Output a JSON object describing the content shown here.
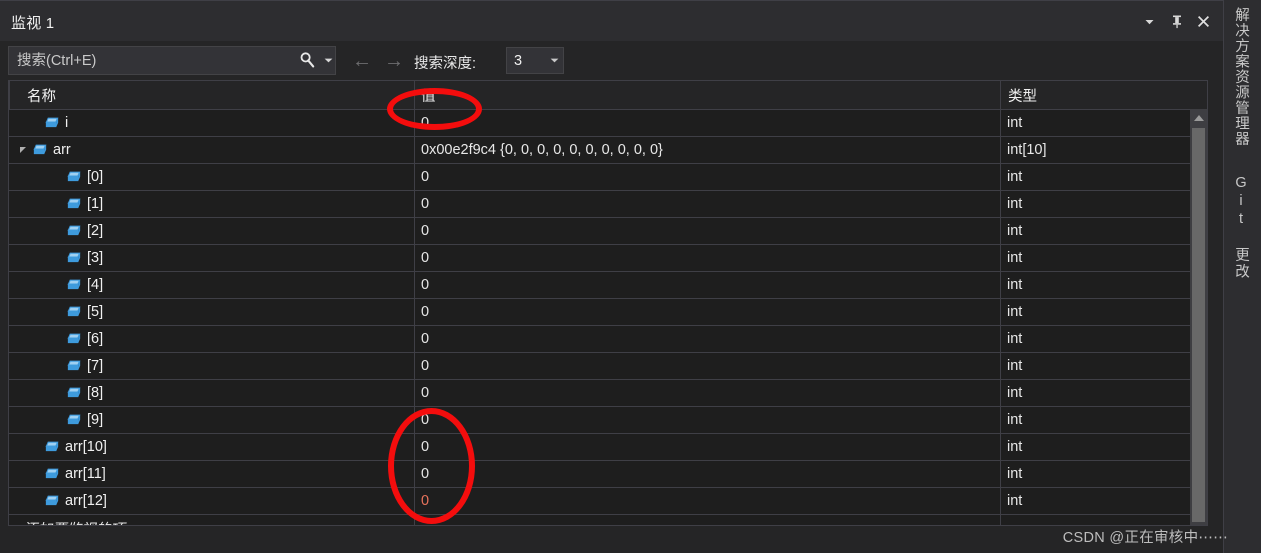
{
  "window": {
    "title": "监视 1",
    "buttons": [
      {
        "name": "window-dropdown",
        "icon": "chevron-down-icon"
      },
      {
        "name": "window-pin",
        "icon": "pin-icon"
      },
      {
        "name": "window-close",
        "icon": "close-icon"
      }
    ]
  },
  "toolbar": {
    "search_placeholder": "搜索(Ctrl+E)",
    "search_value": "",
    "search_icon": "magnifier-icon",
    "search_dropdown_icon": "chevron-down-icon",
    "back_arrow": "←",
    "forward_arrow": "→",
    "depth_label": "搜索深度:",
    "depth_value": "3",
    "depth_caret_icon": "chevron-down-icon"
  },
  "grid": {
    "columns": [
      {
        "key": "name",
        "label": "名称"
      },
      {
        "key": "value",
        "label": "值"
      },
      {
        "key": "type",
        "label": "类型"
      }
    ],
    "rows": [
      {
        "name": "i",
        "value": "0",
        "type": "int",
        "indent": 1,
        "expander": "none",
        "changed": false
      },
      {
        "name": "arr",
        "value": "0x00e2f9c4 {0, 0, 0, 0, 0, 0, 0, 0, 0, 0}",
        "type": "int[10]",
        "indent": 1,
        "expander": "expanded",
        "changed": false
      },
      {
        "name": "[0]",
        "value": "0",
        "type": "int",
        "indent": 2,
        "expander": "none",
        "changed": false
      },
      {
        "name": "[1]",
        "value": "0",
        "type": "int",
        "indent": 2,
        "expander": "none",
        "changed": false
      },
      {
        "name": "[2]",
        "value": "0",
        "type": "int",
        "indent": 2,
        "expander": "none",
        "changed": false
      },
      {
        "name": "[3]",
        "value": "0",
        "type": "int",
        "indent": 2,
        "expander": "none",
        "changed": false
      },
      {
        "name": "[4]",
        "value": "0",
        "type": "int",
        "indent": 2,
        "expander": "none",
        "changed": false
      },
      {
        "name": "[5]",
        "value": "0",
        "type": "int",
        "indent": 2,
        "expander": "none",
        "changed": false
      },
      {
        "name": "[6]",
        "value": "0",
        "type": "int",
        "indent": 2,
        "expander": "none",
        "changed": false
      },
      {
        "name": "[7]",
        "value": "0",
        "type": "int",
        "indent": 2,
        "expander": "none",
        "changed": false
      },
      {
        "name": "[8]",
        "value": "0",
        "type": "int",
        "indent": 2,
        "expander": "none",
        "changed": false
      },
      {
        "name": "[9]",
        "value": "0",
        "type": "int",
        "indent": 2,
        "expander": "none",
        "changed": false
      },
      {
        "name": "arr[10]",
        "value": "0",
        "type": "int",
        "indent": 1,
        "expander": "none",
        "changed": false
      },
      {
        "name": "arr[11]",
        "value": "0",
        "type": "int",
        "indent": 1,
        "expander": "none",
        "changed": false
      },
      {
        "name": "arr[12]",
        "value": "0",
        "type": "int",
        "indent": 1,
        "expander": "none",
        "changed": true
      }
    ],
    "add_item_placeholder": "添加要监视的项"
  },
  "right_strip": {
    "tabs": [
      {
        "label": "解决方案资源管理器",
        "name": "solution-explorer"
      },
      {
        "label": "Git 更改",
        "name": "git-changes"
      }
    ]
  },
  "watermark": "CSDN @正在审核中⋯⋯",
  "colors": {
    "accent_red": "#f40d0d",
    "changed_value": "#e8735c",
    "icon_blue": "#3e9bdd",
    "panel_bg": "#252526",
    "grid_bg": "#1e1e1e"
  },
  "annotations": [
    {
      "name": "value-header-highlight",
      "shape": "ellipse"
    },
    {
      "name": "values-column-highlight",
      "shape": "ellipse"
    }
  ]
}
